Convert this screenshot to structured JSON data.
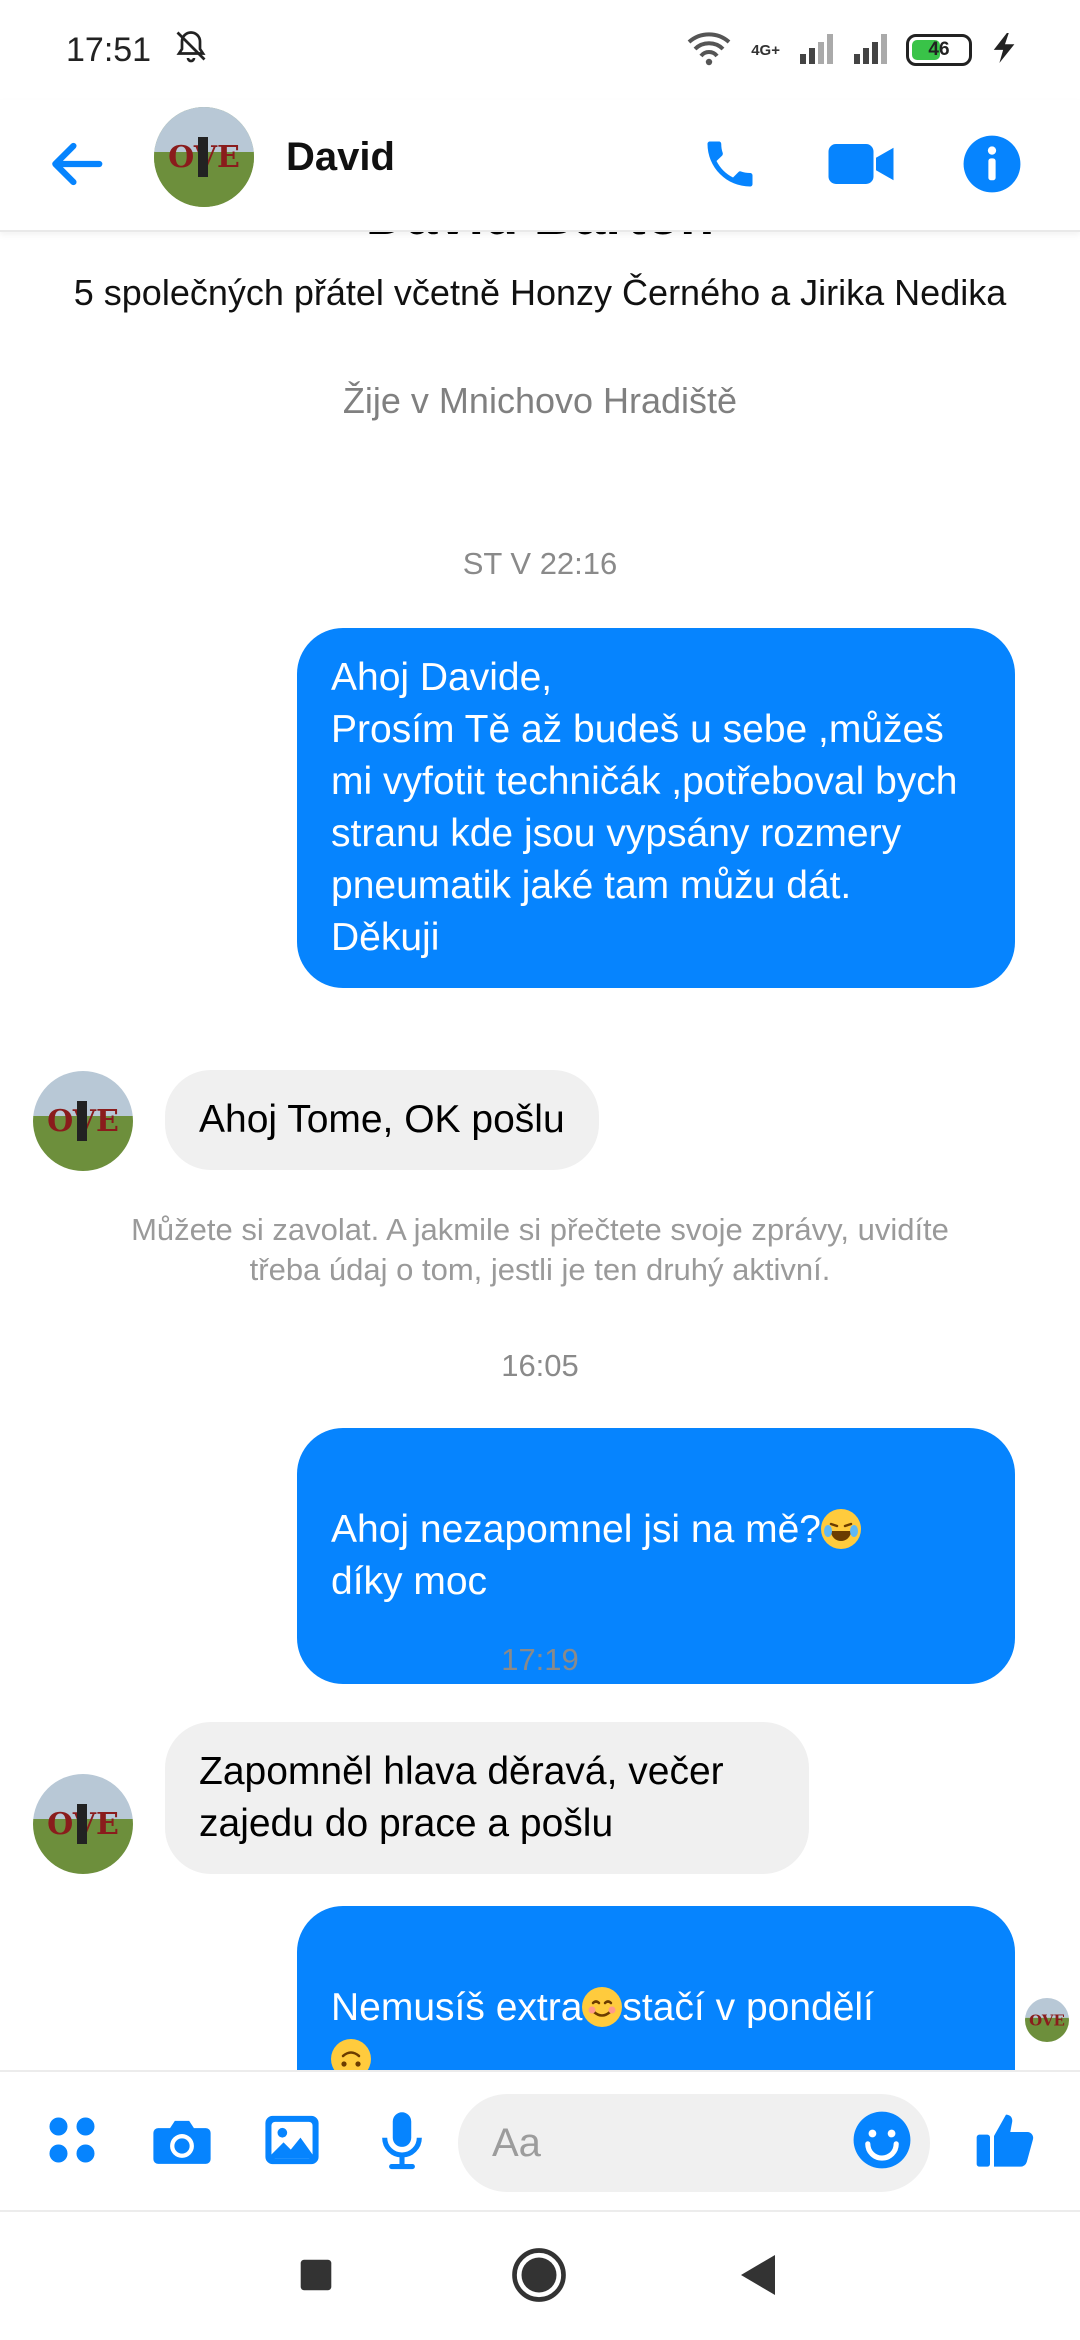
{
  "status_bar": {
    "time": "17:51",
    "network": "4G+",
    "battery": "46",
    "icons": [
      "mute-bell-icon",
      "wifi-icon",
      "signal-icon",
      "signal-icon",
      "battery-icon",
      "charging-icon"
    ]
  },
  "header": {
    "contact_name": "David",
    "icons": [
      "back-arrow-icon",
      "phone-icon",
      "video-icon",
      "info-icon"
    ],
    "accent": "#0684fe"
  },
  "profile": {
    "name_cut": "David Barton",
    "mutual_friends": "5 společných přátel včetně Honzy Černého a Jirika Nedika",
    "lives_in": "Žije v Mnichovo Hradiště"
  },
  "messages": [
    {
      "type": "timestamp",
      "text": "ST V 22:16"
    },
    {
      "type": "outgoing",
      "text": "Ahoj Davide,\nProsím Tě až budeš u sebe ,můžeš mi vyfotit techničák   ,potřeboval bych stranu kde jsou vypsány rozmery pneumatik jaké tam můžu dát.\nDěkuji"
    },
    {
      "type": "incoming",
      "text": "Ahoj Tome, OK pošlu"
    },
    {
      "type": "info",
      "text": "Můžete si zavolat. A jakmile si přečtete svoje zprávy, uvidíte třeba údaj o tom, jestli je ten druhý aktivní."
    },
    {
      "type": "timestamp",
      "text": "16:05"
    },
    {
      "type": "outgoing",
      "text": "Ahoj nezapomnel jsi na mě?",
      "text_after": "díky moc"
    },
    {
      "type": "timestamp",
      "text": "17:19"
    },
    {
      "type": "incoming",
      "text": "Zapomněl hlava děravá, večer\nzajedu do prace a pošlu"
    },
    {
      "type": "outgoing",
      "text": "Nemusíš extra",
      "text_mid": "stačí v pondělí"
    }
  ],
  "composer": {
    "placeholder": "Aa",
    "icons": [
      "apps-grid-icon",
      "camera-icon",
      "gallery-icon",
      "microphone-icon",
      "emoji-icon",
      "thumbs-up-icon"
    ]
  },
  "colors": {
    "outgoing_bubble": "#0684fe",
    "incoming_bubble": "#f0f0f0",
    "timestamp": "#8a8a8a"
  }
}
